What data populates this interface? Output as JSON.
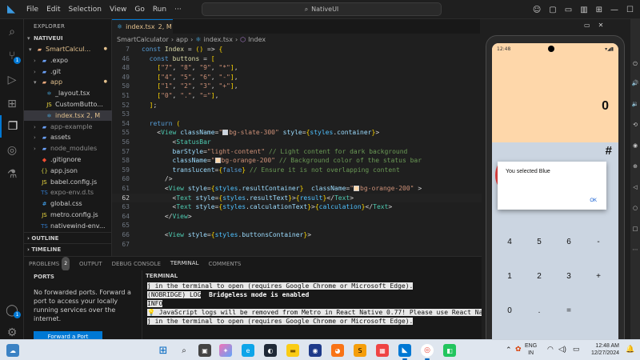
{
  "window": {
    "menu": [
      "File",
      "Edit",
      "Selection",
      "View",
      "Go",
      "Run"
    ],
    "more_menu": "···",
    "search_text": "NativeUI"
  },
  "explorer": {
    "title": "EXPLORER",
    "project": "NATIVEUI",
    "tree": [
      {
        "label": "SmartCalcul...",
        "kind": "folder",
        "indent": 1,
        "open": true,
        "color": "#e2c08d",
        "dot": true
      },
      {
        "label": ".expo",
        "kind": "folder",
        "indent": 2,
        "open": false,
        "color": "#cccccc"
      },
      {
        "label": ".git",
        "kind": "folder",
        "indent": 2,
        "open": false,
        "color": "#cccccc"
      },
      {
        "label": "app",
        "kind": "folder",
        "indent": 2,
        "open": true,
        "color": "#e2c08d",
        "dot": true
      },
      {
        "label": "_layout.tsx",
        "kind": "file",
        "indent": 3,
        "color": "#cccccc",
        "icon": "⚛"
      },
      {
        "label": "CustomButto...",
        "kind": "file",
        "indent": 3,
        "color": "#cccccc",
        "icon": "JS"
      },
      {
        "label": "index.tsx  2, M",
        "kind": "file",
        "indent": 3,
        "color": "#e2c08d",
        "icon": "⚛",
        "selected": true
      },
      {
        "label": "app-example",
        "kind": "folder",
        "indent": 2,
        "open": false,
        "color": "#8b8b8b"
      },
      {
        "label": "assets",
        "kind": "folder",
        "indent": 2,
        "open": false,
        "color": "#cccccc"
      },
      {
        "label": "node_modules",
        "kind": "folder",
        "indent": 2,
        "open": false,
        "color": "#8b8b8b"
      },
      {
        "label": ".gitignore",
        "kind": "file",
        "indent": 2,
        "color": "#cccccc",
        "icon": "◆"
      },
      {
        "label": "app.json",
        "kind": "file",
        "indent": 2,
        "color": "#cccccc",
        "icon": "{}"
      },
      {
        "label": "babel.config.js",
        "kind": "file",
        "indent": 2,
        "color": "#cccccc",
        "icon": "JS"
      },
      {
        "label": "expo-env.d.ts",
        "kind": "file",
        "indent": 2,
        "color": "#8b8b8b",
        "icon": "TS"
      },
      {
        "label": "global.css",
        "kind": "file",
        "indent": 2,
        "color": "#cccccc",
        "icon": "#"
      },
      {
        "label": "metro.config.js",
        "kind": "file",
        "indent": 2,
        "color": "#cccccc",
        "icon": "JS"
      },
      {
        "label": "nativewind-env...",
        "kind": "file",
        "indent": 2,
        "color": "#cccccc",
        "icon": "TS"
      }
    ],
    "sections": [
      "OUTLINE",
      "TIMELINE"
    ]
  },
  "editor": {
    "tab_label": "index.tsx",
    "tab_status": "2, M",
    "breadcrumb": [
      "SmartCalculator",
      "app",
      "index.tsx",
      "Index"
    ],
    "current_line": 62,
    "lines": [
      {
        "n": 7,
        "code": "const Index = () => {"
      },
      {
        "n": 46,
        "code": "  const buttons = ["
      },
      {
        "n": 48,
        "code": "    [\"7\", \"8\", \"9\", \"*\"],"
      },
      {
        "n": 49,
        "code": "    [\"4\", \"5\", \"6\", \"-\"],"
      },
      {
        "n": 50,
        "code": "    [\"1\", \"2\", \"3\", \"+\"],"
      },
      {
        "n": 51,
        "code": "    [\"0\", \".\", \"=\"],"
      },
      {
        "n": 52,
        "code": "  ];"
      },
      {
        "n": 53,
        "code": ""
      },
      {
        "n": 54,
        "code": "  return ("
      },
      {
        "n": 55,
        "code": "    <View className=\"bg-slate-300\" style={styles.container}>"
      },
      {
        "n": 56,
        "code": "        <StatusBar"
      },
      {
        "n": 57,
        "code": "        barStyle=\"light-content\" // Light content for dark background"
      },
      {
        "n": 58,
        "code": "        className=\"bg-orange-200\" // Background color of the status bar"
      },
      {
        "n": 59,
        "code": "        translucent={false} // Ensure it is not overlapping content"
      },
      {
        "n": 60,
        "code": "      />"
      },
      {
        "n": 61,
        "code": "      <View style={styles.resultContainer}  className=\"bg-orange-200\" >"
      },
      {
        "n": 62,
        "code": "        <Text style={styles.resultText}>{result}</Text>"
      },
      {
        "n": 63,
        "code": "        <Text style={styles.calculationText}>{calculation}</Text>"
      },
      {
        "n": 64,
        "code": "      </View>"
      },
      {
        "n": 65,
        "code": ""
      },
      {
        "n": 66,
        "code": "      <View style={styles.buttonsContainer}>"
      },
      {
        "n": 67,
        "code": ""
      }
    ]
  },
  "panel": {
    "tabs": [
      {
        "label": "PROBLEMS",
        "count": "2"
      },
      {
        "label": "OUTPUT"
      },
      {
        "label": "DEBUG CONSOLE"
      },
      {
        "label": "TERMINAL",
        "active": true
      },
      {
        "label": "COMMENTS"
      }
    ],
    "ports": {
      "title": "PORTS",
      "message": "No forwarded ports. Forward a port to access your locally running services over the internet.",
      "button": "Forward a Port"
    },
    "terminal": {
      "title": "TERMINAL",
      "lines": [
        {
          "pre": "",
          "hl": "j in the terminal to open (requires Google Chrome or Microsoft Edge).",
          "post": ""
        },
        {
          "pre": "",
          "hl": "(NOBRIDGE) LOG",
          "post": "  Bridgeless mode is enabled"
        },
        {
          "pre": "",
          "hl": "INFO",
          "post": ""
        },
        {
          "pre": "",
          "hl": "💡 JavaScript logs will be removed from Metro in React Native 0.77! Please use React Native DevTools as your default tool. Tip: Type",
          "post": ""
        },
        {
          "pre": "",
          "hl": "j in the terminal to open (requires Google Chrome or Microsoft Edge).",
          "post": ""
        }
      ]
    }
  },
  "phone": {
    "status_time": "12:48",
    "result": "0",
    "calculation": "#",
    "keys": [
      [
        "4",
        "5",
        "6",
        "-"
      ],
      [
        "1",
        "2",
        "3",
        "+"
      ],
      [
        "0",
        ".",
        "="
      ]
    ],
    "dialog": {
      "message": "You selected Blue",
      "ok": "OK"
    }
  },
  "taskbar": {
    "lang_top": "ENG",
    "lang_bottom": "IN",
    "time": "12:48 AM",
    "date": "12/27/2024"
  },
  "colors": {
    "accent": "#0078d4",
    "orange_200": "#fed7aa",
    "slate_300": "#cbd5e1",
    "modified": "#e2c08d"
  }
}
